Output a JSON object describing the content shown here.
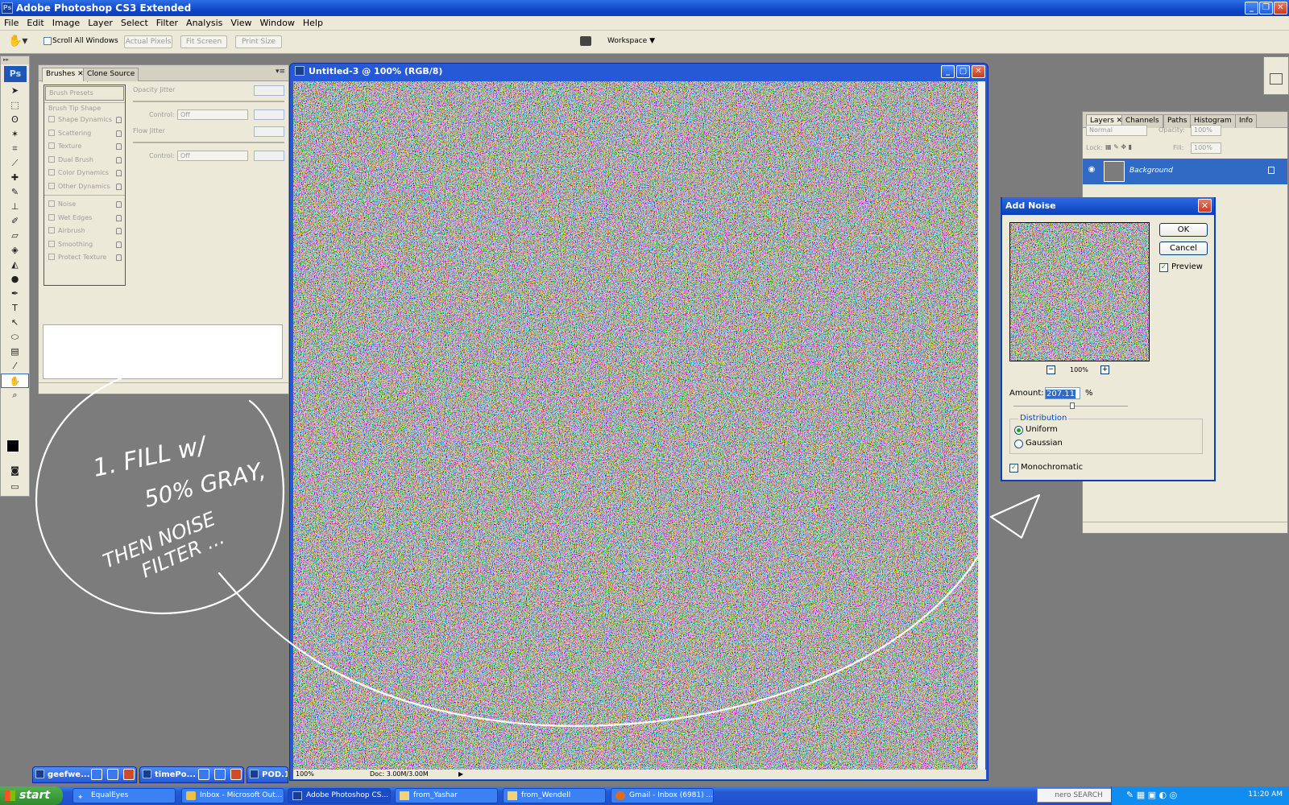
{
  "app": {
    "title": "Adobe Photoshop CS3 Extended"
  },
  "menu": [
    "File",
    "Edit",
    "Image",
    "Layer",
    "Select",
    "Filter",
    "Analysis",
    "View",
    "Window",
    "Help"
  ],
  "options_bar": {
    "scroll_all": "Scroll All Windows",
    "actual_pixels": "Actual Pixels",
    "fit_screen": "Fit Screen",
    "print_size": "Print Size",
    "workspace": "Workspace"
  },
  "tools": {
    "logo": "Ps",
    "icons": [
      "move-icon",
      "marquee-icon",
      "lasso-icon",
      "magic-wand-icon",
      "crop-icon",
      "slice-icon",
      "healing-brush-icon",
      "brush-icon",
      "clone-stamp-icon",
      "history-brush-icon",
      "eraser-icon",
      "paint-bucket-icon",
      "blur-icon",
      "dodge-icon",
      "pen-icon",
      "type-icon",
      "path-selection-icon",
      "shape-icon",
      "notes-icon",
      "eyedropper-icon",
      "hand-icon",
      "zoom-icon"
    ]
  },
  "brushes_panel": {
    "tabs": [
      "Brushes",
      "Clone Source"
    ],
    "presets": "Brush Presets",
    "tip_shape": "Brush Tip Shape",
    "items_a": [
      "Shape Dynamics",
      "Scattering",
      "Texture",
      "Dual Brush",
      "Color Dynamics",
      "Other Dynamics"
    ],
    "items_b": [
      "Noise",
      "Wet Edges",
      "Airbrush",
      "Smoothing",
      "Protect Texture"
    ],
    "opacity_jitter": "Opacity Jitter",
    "flow_jitter": "Flow Jitter",
    "control": "Control:",
    "control_value": "Off"
  },
  "document": {
    "title": "Untitled-3 @ 100% (RGB/8)",
    "zoom": "100%",
    "doc_info": "Doc: 3.00M/3.00M"
  },
  "layers_panel": {
    "tabs": [
      "Layers",
      "Channels",
      "Paths",
      "Histogram",
      "Info"
    ],
    "blend_mode": "Normal",
    "opacity_label": "Opacity:",
    "opacity_value": "100%",
    "lock_label": "Lock:",
    "fill_label": "Fill:",
    "fill_value": "100%",
    "layer_name": "Background"
  },
  "add_noise": {
    "title": "Add Noise",
    "ok": "OK",
    "cancel": "Cancel",
    "preview": "Preview",
    "preview_zoom": "100%",
    "amount_label": "Amount:",
    "amount_value": "207.11",
    "amount_unit": "%",
    "distribution": "Distribution",
    "uniform": "Uniform",
    "gaussian": "Gaussian",
    "monochromatic": "Monochromatic"
  },
  "minimized": [
    "geefwe...",
    "timePo...",
    "POD.1"
  ],
  "taskbar": {
    "start": "start",
    "tasks": [
      "EqualEyes",
      "Inbox - Microsoft Out...",
      "Adobe Photoshop CS...",
      "from_Yashar",
      "from_Wendell",
      "Gmail - Inbox (6981) ..."
    ],
    "nero": "nero SEARCH",
    "clock": "11:20 AM"
  },
  "annotation": {
    "line1": "1. FILL w/",
    "line2": "50% GRAY,",
    "line3": "THEN NOISE",
    "line4": "FILTER ..."
  },
  "colors": {
    "xp_blue": "#2559d8",
    "selection_blue": "#316ac5",
    "panel_bg": "#ece9d8",
    "workspace_gray": "#7c7c7c"
  }
}
